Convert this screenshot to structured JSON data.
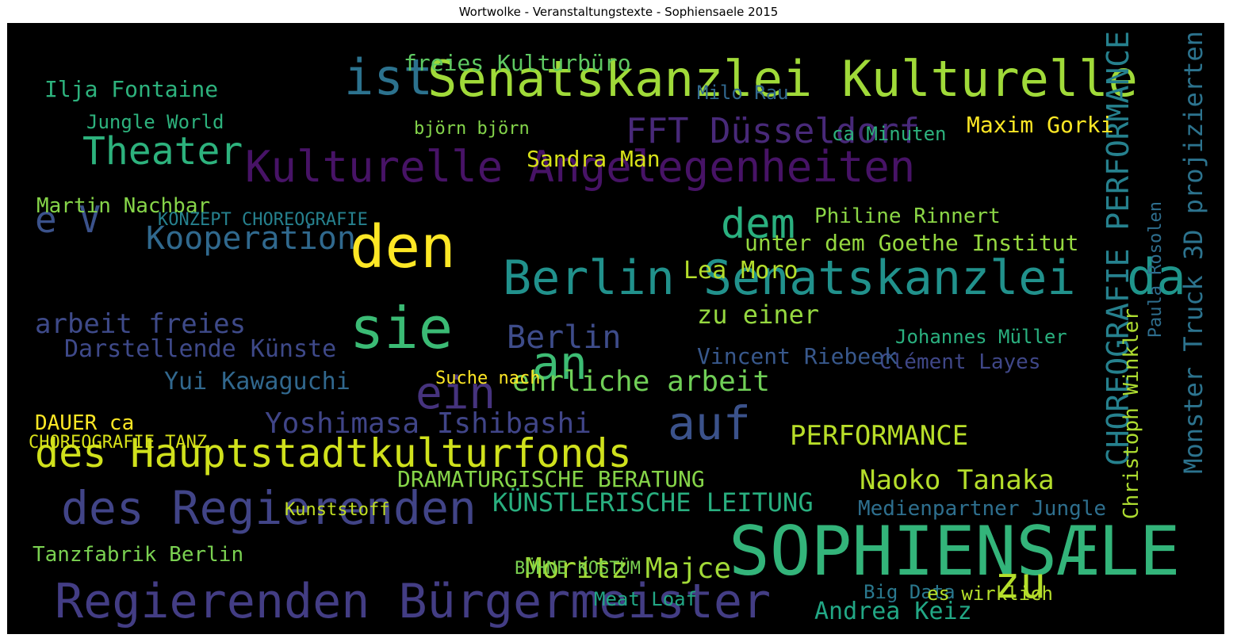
{
  "chart_data": {
    "type": "wordcloud",
    "title": "Wortwolke - Veranstaltungstexte - Sophiensaele 2015",
    "background": "#000000",
    "colormap": "viridis",
    "words": [
      {
        "text": "SOPHIENSÆLE",
        "color": "#33b47a"
      },
      {
        "text": "Senatskanzlei Kulturelle",
        "color": "#a0da39"
      },
      {
        "text": "Kulturelle Angelegenheiten",
        "color": "#471366"
      },
      {
        "text": "Regierenden Bürgermeister",
        "color": "#433d84"
      },
      {
        "text": "des Regierenden",
        "color": "#414487"
      },
      {
        "text": "Berlin Senatskanzlei",
        "color": "#21918c"
      },
      {
        "text": "des Hauptstadtkulturfonds",
        "color": "#d0e11c"
      },
      {
        "text": "den",
        "color": "#fde725"
      },
      {
        "text": "sie",
        "color": "#3bbb75"
      },
      {
        "text": "ist",
        "color": "#2c728e"
      },
      {
        "text": "auf",
        "color": "#3b528b"
      },
      {
        "text": "ein",
        "color": "#46337e"
      },
      {
        "text": "an",
        "color": "#3dbc74"
      },
      {
        "text": "zu",
        "color": "#b5de2b"
      },
      {
        "text": "dem",
        "color": "#2ab07f"
      },
      {
        "text": "da",
        "color": "#1f958b"
      },
      {
        "text": "e V",
        "color": "#3b528b"
      },
      {
        "text": "Theater",
        "color": "#2db27d"
      },
      {
        "text": "CHOREOGRAFIE PERFORMANCE",
        "color": "#26818e"
      },
      {
        "text": "FFT Düsseldorf",
        "color": "#482979"
      },
      {
        "text": "Kooperation",
        "color": "#30698e"
      },
      {
        "text": "ehrliche arbeit",
        "color": "#70cf57"
      },
      {
        "text": "PERFORMANCE",
        "color": "#b8de29"
      },
      {
        "text": "KÜNSTLERISCHE LEITUNG",
        "color": "#29af7f"
      },
      {
        "text": "DRAMATURGISCHE BERATUNG",
        "color": "#86d549"
      },
      {
        "text": "Naoko Tanaka",
        "color": "#b5de2b"
      },
      {
        "text": "Monster Truck 3D projizierten",
        "color": "#2c738e"
      },
      {
        "text": "Yoshimasa Ishibashi",
        "color": "#404588"
      },
      {
        "text": "Darstellende Künste",
        "color": "#3e4989"
      },
      {
        "text": "arbeit freies",
        "color": "#3e4a89"
      },
      {
        "text": "Moritz Majce",
        "color": "#a2da37"
      },
      {
        "text": "Tanzfabrik Berlin",
        "color": "#7ad151"
      },
      {
        "text": "Andrea Keiz",
        "color": "#22a785"
      },
      {
        "text": "freies Kulturbüro",
        "color": "#5ec962"
      },
      {
        "text": "unter dem Goethe Institut",
        "color": "#95d840"
      },
      {
        "text": "Philine Rinnert",
        "color": "#8bd646"
      },
      {
        "text": "Johannes Müller",
        "color": "#2ab07f"
      },
      {
        "text": "Clément Layes",
        "color": "#3f4788"
      },
      {
        "text": "Vincent Riebeek",
        "color": "#38588c"
      },
      {
        "text": "Lea Moro",
        "color": "#b5de2b"
      },
      {
        "text": "Maxim Gorki",
        "color": "#fde725"
      },
      {
        "text": "Sandra Man",
        "color": "#d8e219"
      },
      {
        "text": "Yui Kawaguchi",
        "color": "#31688e"
      },
      {
        "text": "Christoph Winkler",
        "color": "#addc30"
      },
      {
        "text": "Paula Rosolen",
        "color": "#2e6e8e"
      },
      {
        "text": "Medienpartner Jungle",
        "color": "#2e6f8e"
      },
      {
        "text": "Berlin",
        "color": "#3e4c8a"
      },
      {
        "text": "zu einer",
        "color": "#95d840"
      },
      {
        "text": "Ilja Fontaine",
        "color": "#2db27d"
      },
      {
        "text": "Martin Nachbar",
        "color": "#86d549"
      },
      {
        "text": "KONZEPT CHOREOGRAFIE",
        "color": "#26818e"
      },
      {
        "text": "DAUER ca",
        "color": "#fde725"
      },
      {
        "text": "CHOREOGRAFIE TANZ",
        "color": "#d8e219"
      },
      {
        "text": "Jungle World",
        "color": "#2db27d"
      },
      {
        "text": "BÜHNE KOSTÜM",
        "color": "#7ad151"
      },
      {
        "text": "Meat Loaf",
        "color": "#22a785"
      },
      {
        "text": "Big Data",
        "color": "#2a788e"
      },
      {
        "text": "es wirklich",
        "color": "#b5de2b"
      },
      {
        "text": "Suche nach",
        "color": "#fde725"
      },
      {
        "text": "Milo Rau",
        "color": "#31688e"
      },
      {
        "text": "björn björn",
        "color": "#84d44b"
      },
      {
        "text": "ca Minuten",
        "color": "#2db27d"
      },
      {
        "text": "Kunststoff",
        "color": "#c2df23"
      }
    ]
  }
}
